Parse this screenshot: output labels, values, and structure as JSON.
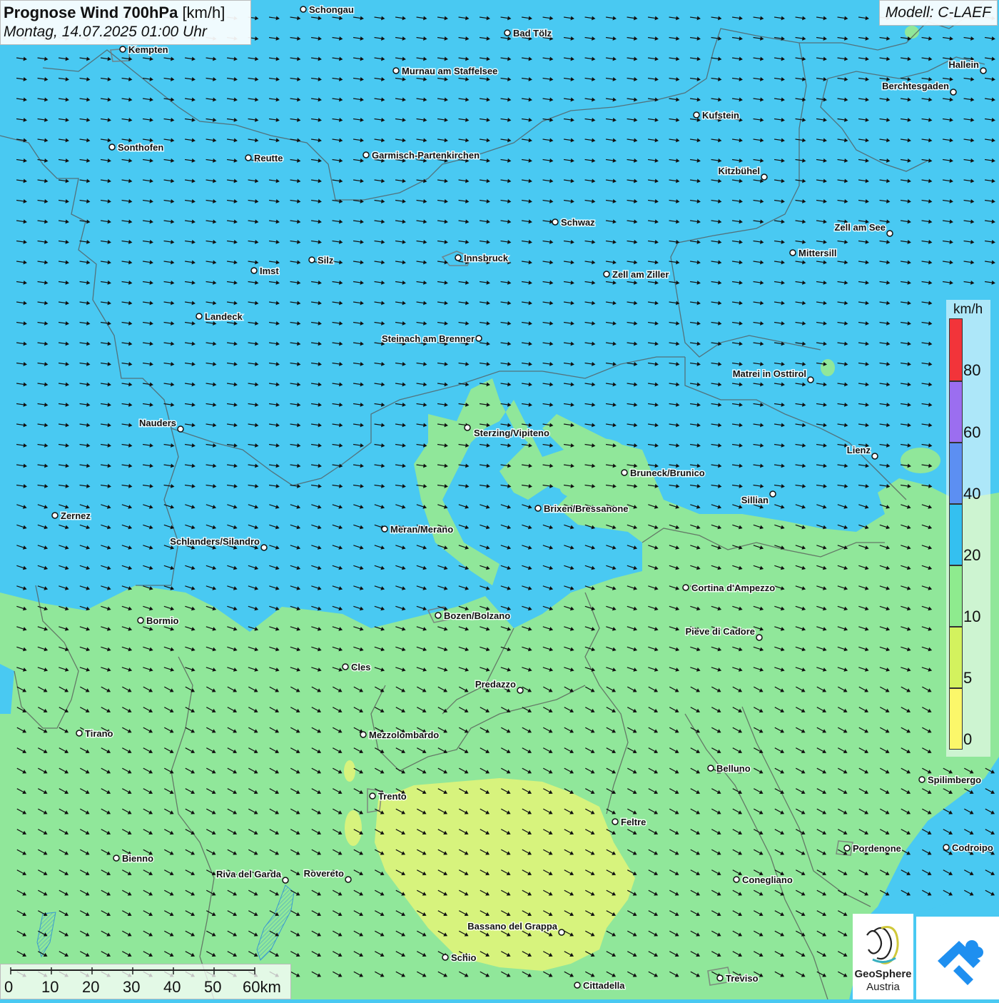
{
  "header": {
    "title_bold": "Prognose Wind 700hPa",
    "title_unit": "[km/h]",
    "datetime": "Montag, 14.07.2025 01:00 Uhr",
    "model": "Modell: C-LAEF"
  },
  "legend": {
    "unit": "km/h",
    "ticks": [
      "80",
      "60",
      "40",
      "20",
      "10",
      "5",
      "0"
    ],
    "colors": {
      "c80": "#f2343a",
      "c60": "#9b6ef0",
      "c40": "#5c8ff2",
      "c20": "#34c0f0",
      "c10": "#8eeb8e",
      "c5": "#d3f25e",
      "c0": "#fbf76a"
    }
  },
  "map_colors": {
    "wind_20_40": "#49c9f2",
    "wind_10_20": "#90e79a",
    "wind_5_10": "#d7f37d"
  },
  "wind_direction": "west-northwest, arrows pointing east-southeast",
  "scalebar": {
    "labels": [
      "0",
      "10",
      "20",
      "30",
      "40",
      "50",
      "60km"
    ]
  },
  "logos": {
    "geosphere_line1": "GeoSphere",
    "geosphere_line2": "Austria",
    "app_icon": "wetter-app-icon"
  },
  "cities": [
    {
      "name": "Schongau"
    },
    {
      "name": "Bad Tölz"
    },
    {
      "name": "Kempten"
    },
    {
      "name": "Murnau am Staffelsee"
    },
    {
      "name": "Hallein"
    },
    {
      "name": "Berchtesgaden"
    },
    {
      "name": "Kufstein"
    },
    {
      "name": "Sonthofen"
    },
    {
      "name": "Reutte"
    },
    {
      "name": "Garmisch-Partenkirchen"
    },
    {
      "name": "Kitzbühel"
    },
    {
      "name": "Schwaz"
    },
    {
      "name": "Zell am See"
    },
    {
      "name": "Mittersill"
    },
    {
      "name": "Innsbruck"
    },
    {
      "name": "Silz"
    },
    {
      "name": "Imst"
    },
    {
      "name": "Zell am Ziller"
    },
    {
      "name": "Landeck"
    },
    {
      "name": "Steinach am Brenner"
    },
    {
      "name": "Matrei in Osttirol"
    },
    {
      "name": "Nauders"
    },
    {
      "name": "Sterzing/Vipiteno"
    },
    {
      "name": "Lienz"
    },
    {
      "name": "Bruneck/Brunico"
    },
    {
      "name": "Sillian"
    },
    {
      "name": "Brixen/Bressanone"
    },
    {
      "name": "Zernez"
    },
    {
      "name": "Meran/Merano"
    },
    {
      "name": "Schlanders/Silandro"
    },
    {
      "name": "Cortina d'Ampezzo"
    },
    {
      "name": "Bozen/Bolzano"
    },
    {
      "name": "Bormio"
    },
    {
      "name": "Pieve di Cadore"
    },
    {
      "name": "Cles"
    },
    {
      "name": "Predazzo"
    },
    {
      "name": "Tirano"
    },
    {
      "name": "Mezzolombardo"
    },
    {
      "name": "Belluno"
    },
    {
      "name": "Spilimbergo"
    },
    {
      "name": "Trento"
    },
    {
      "name": "Feltre"
    },
    {
      "name": "Bienno"
    },
    {
      "name": "Pordenone"
    },
    {
      "name": "Codroipo"
    },
    {
      "name": "Riva del Garda"
    },
    {
      "name": "Rovereto"
    },
    {
      "name": "Conegliano"
    },
    {
      "name": "Bassano del Grappa"
    },
    {
      "name": "Schio"
    },
    {
      "name": "Treviso"
    },
    {
      "name": "Cittadella"
    }
  ]
}
